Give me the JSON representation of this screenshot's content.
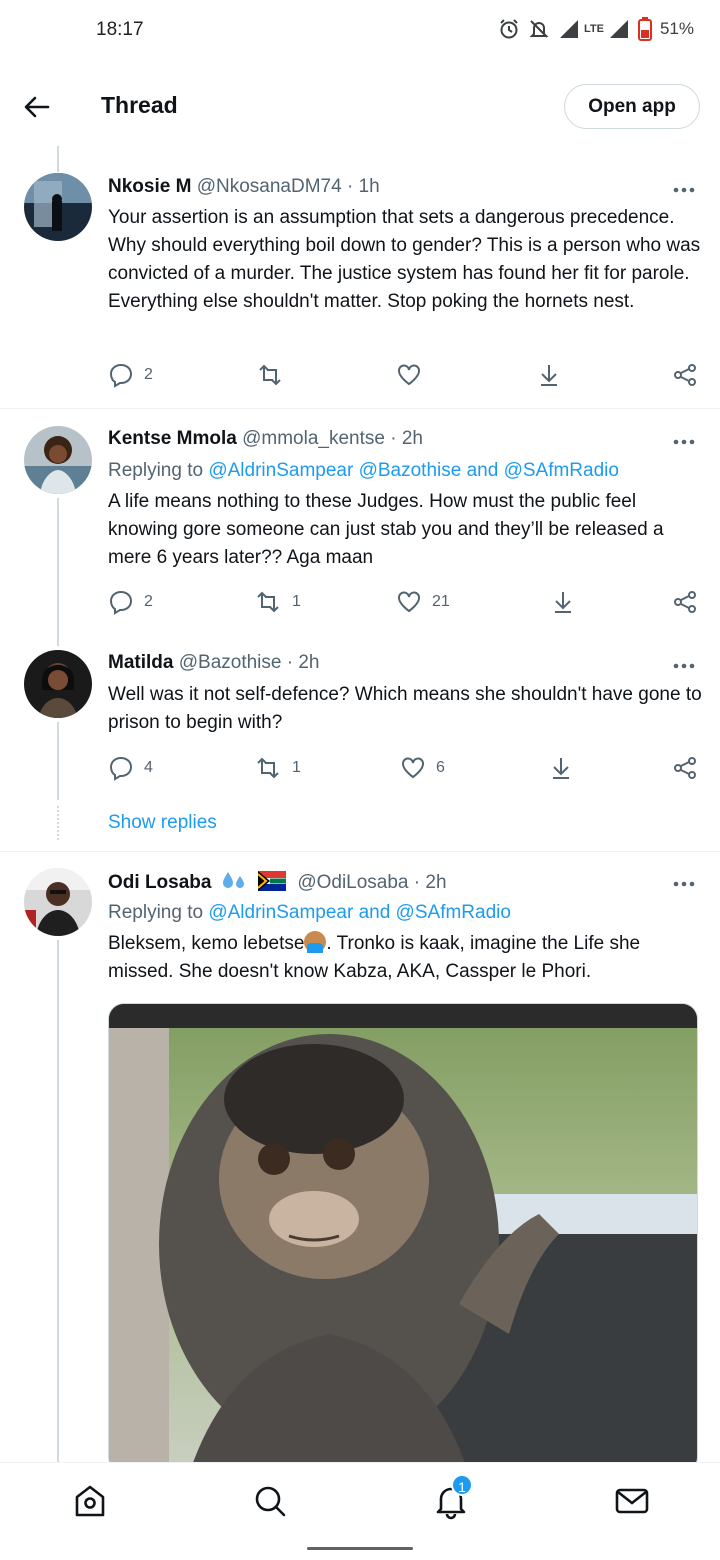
{
  "status_bar": {
    "time": "18:17",
    "network": "LTE",
    "battery": "51%",
    "icons": [
      "alarm-icon",
      "mute-icon",
      "signal-icon",
      "signal-icon",
      "battery-icon"
    ]
  },
  "header": {
    "title": "Thread",
    "open_app_label": "Open app",
    "back_icon": "arrow-left-icon"
  },
  "tweets": [
    {
      "name": "Nkosie M",
      "meta": "@NkosanaDM74 · 1h",
      "text": "Your assertion is an assumption that sets a dangerous precedence. Why should everything boil down to gender? This is a person who was convicted of a murder. The justice system has found her fit for parole. Everything else shouldn't matter. Stop poking the hornets nest.",
      "replies": "2",
      "retweets": "",
      "likes": ""
    },
    {
      "name": "Kentse Mmola",
      "meta": "@mmola_kentse · 2h",
      "replying_prefix": "Replying to",
      "replying_to": "@AldrinSampear @Bazothise and @SAfmRadio",
      "text": "A life means nothing to these Judges. How must the public feel knowing gore someone can just stab you and they’ll be released a mere 6 years later?? Aga maan",
      "replies": "2",
      "retweets": "1",
      "likes": "21"
    },
    {
      "name": "Matilda",
      "meta": "@Bazothise · 2h",
      "text": "Well was it not self-defence? Which means she shouldn't have gone to prison to begin with?",
      "replies": "4",
      "retweets": "1",
      "likes": "6"
    },
    {
      "name": "Odi Losaba",
      "meta": "@OdiLosaba · 2h",
      "replying_prefix": "Replying to",
      "replying_to": "@AldrinSampear and @SAfmRadio",
      "text_a": "Bleksem, kemo lebetse",
      "text_b": ". Tronko is kaak, imagine the Life she missed. She doesn't know Kabza, AKA, Cassper le Phori."
    }
  ],
  "show_replies_label": "Show replies",
  "bottom_nav": {
    "items": [
      "home-icon",
      "search-icon",
      "notifications-icon",
      "messages-icon"
    ],
    "notification_count": "1"
  }
}
